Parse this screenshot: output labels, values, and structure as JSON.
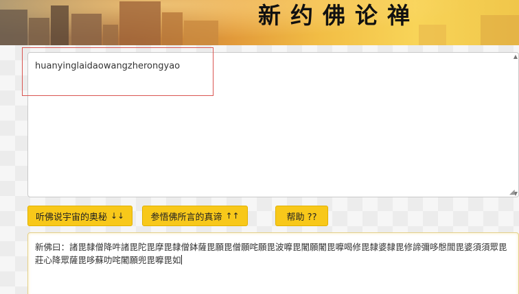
{
  "banner": {
    "title": "新约佛论禅"
  },
  "input": {
    "value": "huanyinglaidaowangzherongyao"
  },
  "buttons": {
    "encode_label": "听佛说宇宙的奥秘",
    "encode_arrows": "↓↓",
    "decode_label": "参悟佛所言的真谛",
    "decode_arrows": "↑↑",
    "help_label": "帮助 ??"
  },
  "output": {
    "text": "新佛曰：諸毘隸僧降吽諸毘陀毘摩毘隸僧鉢薩毘願毘僧願咤願毘波嚤毘闍願闍毘嚤喝修毘隸婆隸毘修諦彌哆慇閭毘婆須須眾毘莊心降眾薩毘哆蘇叻咤闍願兜毘嚤毘如"
  }
}
